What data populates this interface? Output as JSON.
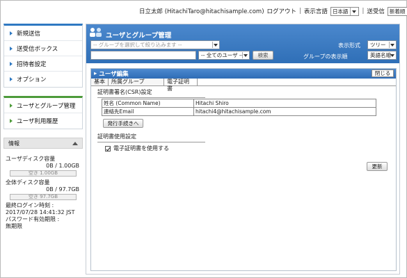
{
  "topbar": {
    "user": "日立太郎 (HitachiTaro@hitachisample.com)",
    "logout": "ログアウト",
    "lang_label": "表示言語",
    "lang_value": "日本語",
    "sender_label": "送受信",
    "sender_value": "新着順"
  },
  "sidebar": {
    "nav": [
      "新規送信",
      "送受信ボックス",
      "招待者設定",
      "オプション"
    ],
    "nav2": [
      "ユーザとグループ管理",
      "ユーザ利用履歴"
    ],
    "info": {
      "title": "情報",
      "user_disk_label": "ユーザディスク容量",
      "user_disk_value": "0B / 1.00GB",
      "user_disk_free": "空き 1.00GB",
      "total_disk_label": "全体ディスク容量",
      "total_disk_value": "0B / 97.7GB",
      "total_disk_free": "空き 97.7GB",
      "last_login_label": "最終ログイン時刻 :",
      "last_login_value": "2017/07/28 14:41:32 JST",
      "pw_label": "パスワード有効期限 :",
      "pw_value": "無期限"
    }
  },
  "main": {
    "title": "ユーザとグループ管理",
    "group_filter_placeholder": "-- グループを選択して絞り込みます --",
    "all_users": "-- 全てのユーザ --",
    "search_button": "検索",
    "display_format_label": "表示形式",
    "display_format_value": "ツリー",
    "group_order_label": "グループの表示順",
    "group_order_value": "英語名順"
  },
  "panel": {
    "title": "ユーザ編集",
    "close_button": "閉じる",
    "tabs": [
      "基本",
      "所属グループ",
      "電子証明書"
    ],
    "csr_section": "証明書署名(CSR)設定",
    "csr_rows": [
      {
        "k": "姓名 (Common Name)",
        "v": "Hitachi Shiro"
      },
      {
        "k": "連絡先Email",
        "v": "hitachi4@hitachisample.com"
      }
    ],
    "issue_button": "発行手続きへ",
    "use_section": "証明書使用設定",
    "use_checkbox_label": "電子証明書を使用する",
    "update_button": "更新"
  }
}
